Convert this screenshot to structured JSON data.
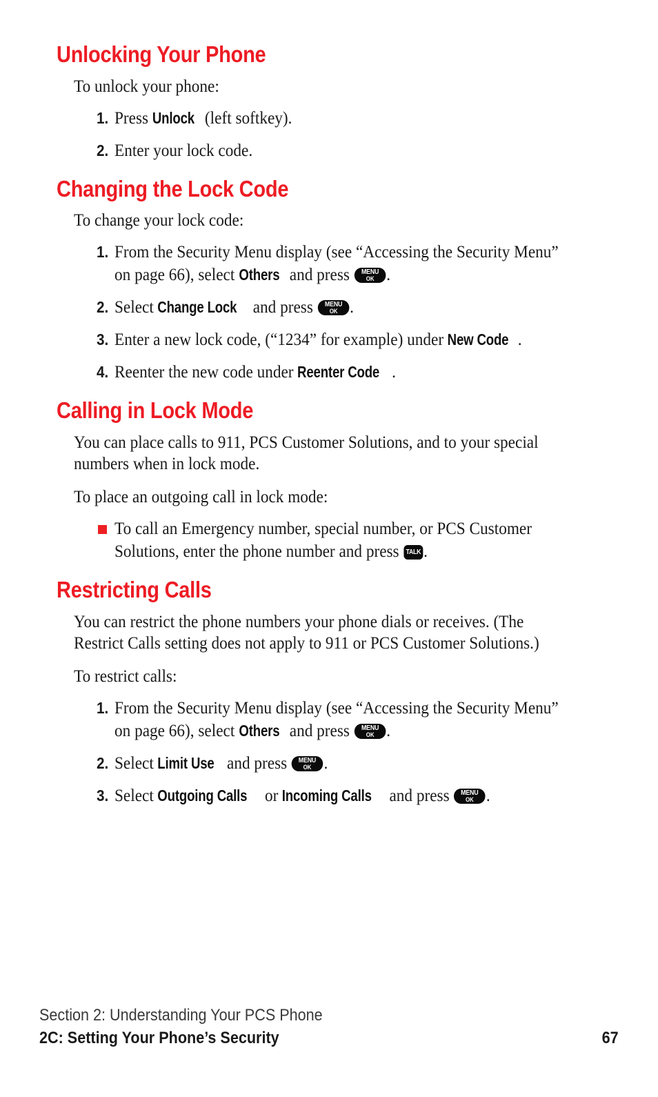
{
  "page": {
    "number": "67",
    "accent_color": "#ED1C24",
    "text_color": "#1a1a1a"
  },
  "sections": [
    {
      "heading": "Unlocking Your Phone",
      "intro": "To unlock your phone:",
      "items": [
        {
          "marker": "1.",
          "pre": "Press ",
          "bold1": "Unlock",
          "post": " (left softkey)."
        },
        {
          "marker": "2.",
          "pre": "Enter your lock code.",
          "bold1": "",
          "post": ""
        }
      ]
    },
    {
      "heading": "Changing the Lock Code",
      "intro": "To change your lock code:",
      "items": [
        {
          "marker": "1.",
          "pre": "From the Security Menu display (see “Accessing the Security Menu” on page 66), select ",
          "bold1": "Others",
          "post": " and press ",
          "key": "menu-ok-key",
          "tail": "."
        },
        {
          "marker": "2.",
          "pre": "Select ",
          "bold1": "Change Lock",
          "post": " and press ",
          "key": "menu-ok-key",
          "tail": "."
        },
        {
          "marker": "3.",
          "pre": "Enter a new lock code, (“1234” for example) under ",
          "bold1": "New Code",
          "post": ".",
          "tail": ""
        },
        {
          "marker": "4.",
          "pre": "Reenter the new code under ",
          "bold1": "Reenter Code",
          "post": ".",
          "tail": ""
        }
      ]
    },
    {
      "heading": "Calling in Lock Mode",
      "para1": "You can place calls to 911, PCS Customer Solutions, and to your special numbers when in lock mode.",
      "intro": "To place an outgoing call in lock mode:",
      "bullets": [
        {
          "pre": "To call an Emergency number, special number, or PCS Customer Solutions, enter the phone number and press ",
          "key": "talk-key",
          "tail": "."
        }
      ]
    },
    {
      "heading": "Restricting Calls",
      "para1": "You can restrict the phone numbers your phone dials or receives. (The Restrict Calls setting does not apply to 911 or PCS Customer Solutions.)",
      "intro": "To restrict calls:",
      "items": [
        {
          "marker": "1.",
          "pre": "From the Security Menu display (see “Accessing the Security Menu” on page 66), select ",
          "bold1": "Others",
          "post": " and press ",
          "key": "menu-ok-key",
          "tail": "."
        },
        {
          "marker": "2.",
          "pre": "Select ",
          "bold1": "Limit Use",
          "post": " and press ",
          "key": "menu-ok-key",
          "tail": "."
        },
        {
          "marker": "3.",
          "pre": "Select ",
          "bold1": "Outgoing Calls",
          "mid": " or ",
          "bold2": "Incoming Calls",
          "post": " and press ",
          "key": "menu-ok-key",
          "tail": "."
        }
      ]
    }
  ],
  "keys": {
    "menu_line1": "MENU",
    "menu_line2": "OK",
    "talk_label": "TALK"
  },
  "footer": {
    "section_line": "Section 2: Understanding Your PCS Phone",
    "chapter_line": "2C: Setting Your Phone’s Security",
    "page_number": "67"
  }
}
